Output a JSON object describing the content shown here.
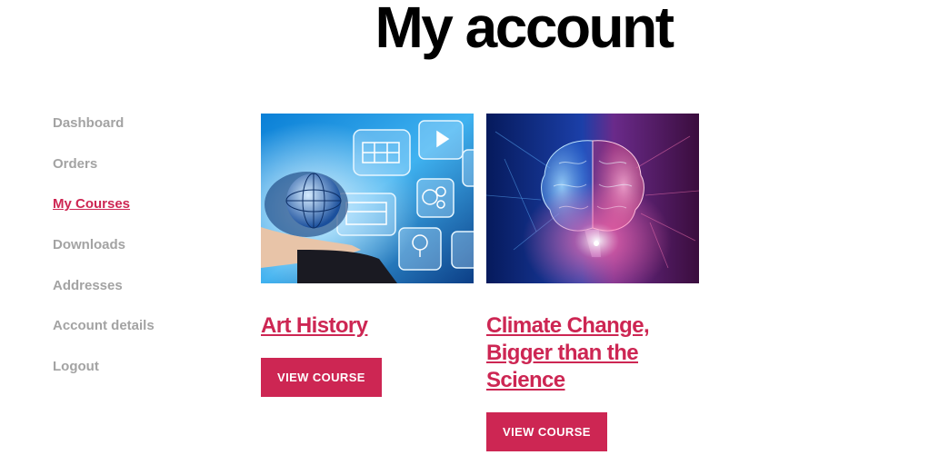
{
  "page": {
    "title": "My account"
  },
  "nav": {
    "items": [
      {
        "label": "Dashboard"
      },
      {
        "label": "Orders"
      },
      {
        "label": "My Courses",
        "active": true
      },
      {
        "label": "Downloads"
      },
      {
        "label": "Addresses"
      },
      {
        "label": "Account details"
      },
      {
        "label": "Logout"
      }
    ]
  },
  "courses": [
    {
      "title": "Art History",
      "button_label": "VIEW COURSE"
    },
    {
      "title": "Climate Change, Bigger than the Science",
      "button_label": "VIEW COURSE"
    }
  ],
  "colors": {
    "accent": "#cd2653",
    "nav_text": "#a3a3a3",
    "title": "#000000"
  }
}
